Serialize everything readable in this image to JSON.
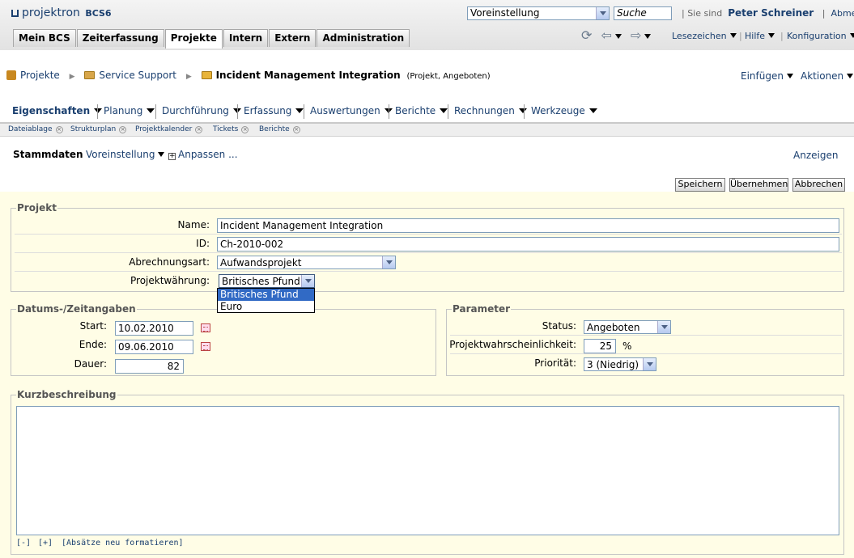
{
  "app": {
    "logo_text": "projektron",
    "logo_suffix": "BCS6"
  },
  "header": {
    "profile_select": "Voreinstellung",
    "search_placeholder": "Suche",
    "signed_in_prefix": "Sie sind",
    "user_name": "Peter Schreiner",
    "logout": "Abmelden",
    "tabs": [
      "Mein BCS",
      "Zeiterfassung",
      "Projekte",
      "Intern",
      "Extern",
      "Administration"
    ],
    "active_tab": "Projekte",
    "nav_right": {
      "bookmarks": "Lesezeichen",
      "help": "Hilfe",
      "config": "Konfiguration"
    }
  },
  "breadcrumb": {
    "items": [
      "Projekte",
      "Service Support"
    ],
    "current": "Incident Management Integration",
    "current_meta": "(Projekt, Angeboten)",
    "insert": "Einfügen",
    "actions": "Aktionen"
  },
  "menu": [
    "Eigenschaften",
    "Planung",
    "Durchführung",
    "Erfassung",
    "Auswertungen",
    "Berichte",
    "Rechnungen",
    "Werkzeuge"
  ],
  "subtabs": [
    "Dateiablage",
    "Strukturplan",
    "Projektkalender",
    "Tickets",
    "Berichte"
  ],
  "view": {
    "title": "Stammdaten",
    "preset": "Voreinstellung",
    "customize": "Anpassen ...",
    "show": "Anzeigen",
    "buttons": {
      "save": "Speichern",
      "apply": "Übernehmen",
      "cancel": "Abbrechen"
    }
  },
  "projekt": {
    "legend": "Projekt",
    "name_label": "Name:",
    "name_value": "Incident Management Integration",
    "id_label": "ID:",
    "id_value": "Ch-2010-002",
    "billing_label": "Abrechnungsart:",
    "billing_value": "Aufwandsprojekt",
    "currency_label": "Projektwährung:",
    "currency_value": "Britisches Pfund",
    "currency_options": [
      "Britisches Pfund",
      "Euro"
    ]
  },
  "dates": {
    "legend": "Datums-/Zeitangaben",
    "start_label": "Start:",
    "start_value": "10.02.2010",
    "end_label": "Ende:",
    "end_value": "09.06.2010",
    "duration_label": "Dauer:",
    "duration_value": "82"
  },
  "params": {
    "legend": "Parameter",
    "status_label": "Status:",
    "status_value": "Angeboten",
    "prob_label": "Projektwahrscheinlichkeit:",
    "prob_value": "25",
    "prob_unit": "%",
    "priority_label": "Priorität:",
    "priority_value": "3 (Niedrig)"
  },
  "desc": {
    "legend": "Kurzbeschreibung",
    "collapse": "[-]",
    "expand": "[+]",
    "reformat": "[Absätze neu formatieren]"
  }
}
